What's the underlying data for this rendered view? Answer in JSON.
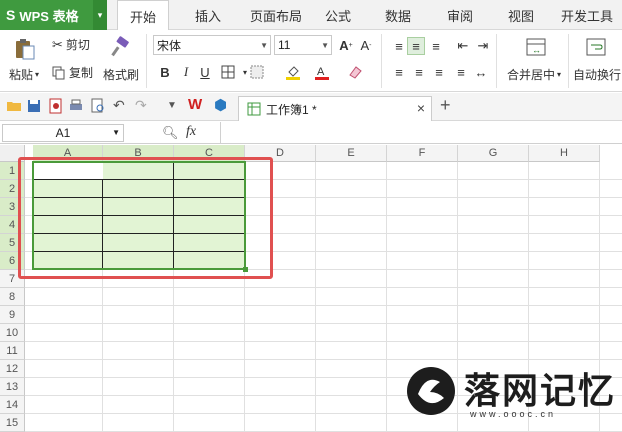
{
  "app": {
    "logo": "S",
    "name": "WPS 表格"
  },
  "tabs": [
    "开始",
    "插入",
    "页面布局",
    "公式",
    "数据",
    "审阅",
    "视图",
    "开发工具"
  ],
  "active_tab": "开始",
  "ribbon": {
    "paste_label": "粘贴",
    "cut_label": "剪切",
    "copy_label": "复制",
    "format_painter_label": "格式刷",
    "font_name": "宋体",
    "font_size": "11",
    "merge_center_label": "合并居中",
    "wrap_text_label": "自动换行"
  },
  "document_tab": {
    "title": "工作簿1 *",
    "close": "×",
    "new": "+"
  },
  "formula_bar": {
    "name_box": "A1",
    "fx": "fx"
  },
  "columns": [
    "A",
    "B",
    "C",
    "D",
    "E",
    "F",
    "G",
    "H"
  ],
  "rows": [
    "1",
    "2",
    "3",
    "4",
    "5",
    "6",
    "7",
    "8",
    "9",
    "10",
    "11",
    "12",
    "13",
    "14",
    "15"
  ],
  "selection": {
    "range": "A1:C6"
  },
  "watermark": {
    "text": "落网记忆",
    "url": "www.oooc.cn"
  },
  "colors": {
    "accent": "#3f9a3f",
    "selection_fill": "#e2f4d4",
    "highlight_box": "#e05050"
  }
}
